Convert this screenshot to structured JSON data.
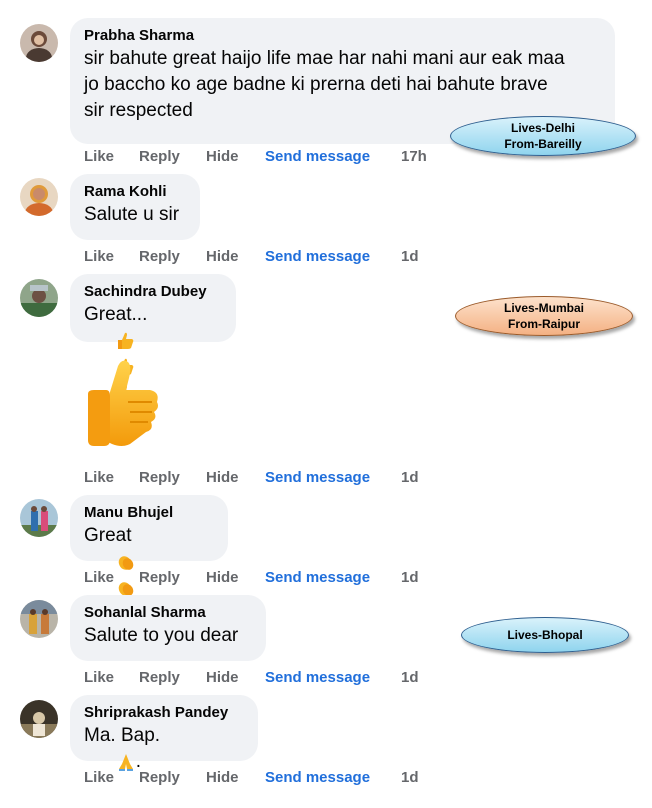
{
  "actions": {
    "like": "Like",
    "reply": "Reply",
    "hide": "Hide",
    "send": "Send message"
  },
  "colors": {
    "bubble": "#f0f2f5",
    "action": "#65676b",
    "link": "#216fdb"
  },
  "comments": [
    {
      "author": "Prabha Sharma",
      "text": "sir bahute great haijo life mae har nahi mani aur eak maa\njo baccho ko age badne ki prerna deti hai bahute brave\nsir respected",
      "time": "17h"
    },
    {
      "author": "Rama Kohli",
      "text": "Salute u sir",
      "time": "1d"
    },
    {
      "author": "Sachindra Dubey",
      "text": "Great...",
      "emoji": "thumbs-up-icon x3",
      "sticker": "thumbs-up-sticker",
      "time": "1d"
    },
    {
      "author": "Manu Bhujel",
      "text": "Great",
      "emoji": "clapping-hands-icon x3",
      "time": "1d"
    },
    {
      "author": "Sohanlal Sharma",
      "text": "Salute to you dear",
      "time": "1d"
    },
    {
      "author": "Shriprakash Pandey",
      "text": "Ma. Bap.",
      "emoji": "folded-hands-icon",
      "text_after": ".",
      "time": "1d"
    }
  ],
  "labels": [
    {
      "line1": "Lives-Delhi",
      "line2": "From-Bareilly",
      "color": "#8fd4ee"
    },
    {
      "line1": "Lives-Mumbai",
      "line2": "From-Raipur",
      "color": "#f4b183"
    },
    {
      "line1": "Lives-Bhopal",
      "color": "#8fd4ee"
    }
  ]
}
